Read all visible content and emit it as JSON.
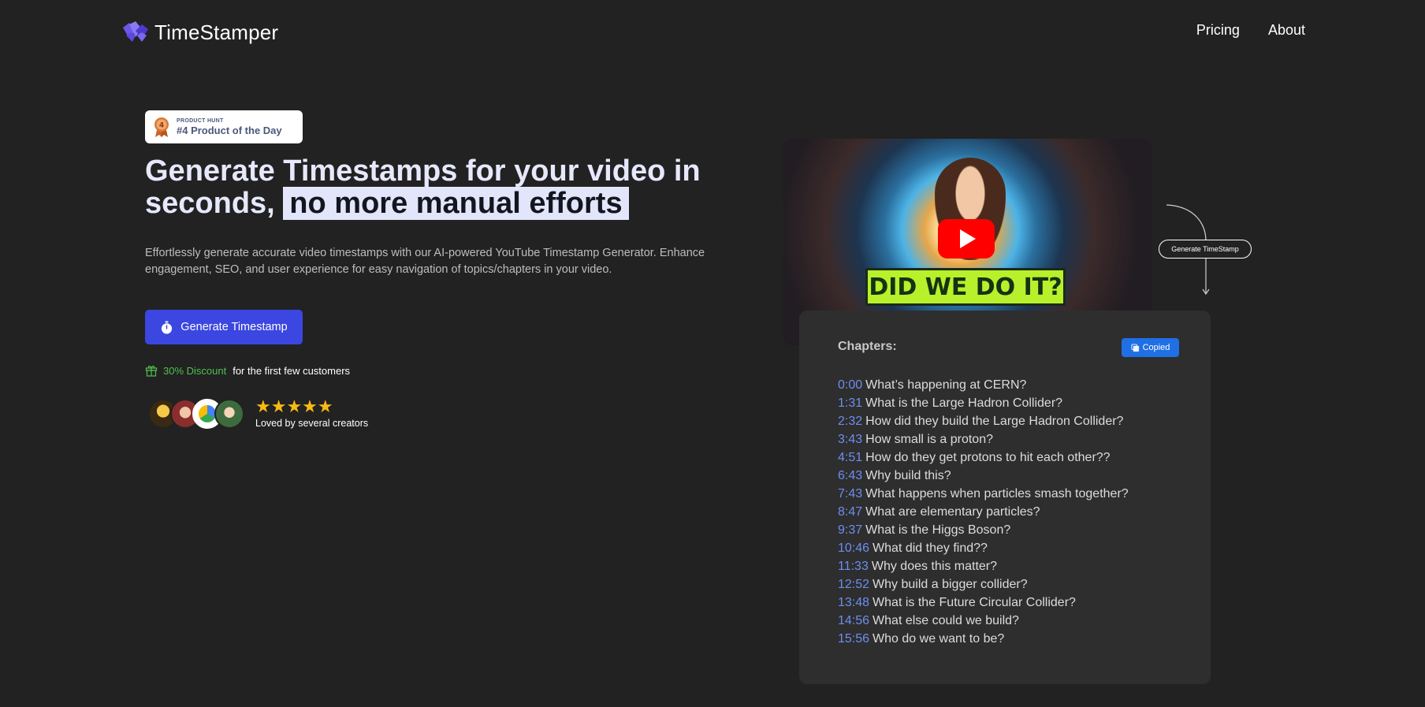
{
  "header": {
    "brand": "TimeStamper",
    "nav": [
      "Pricing",
      "About"
    ]
  },
  "badge": {
    "small": "PRODUCT HUNT",
    "big": "#4 Product of the Day",
    "medal_number": "4"
  },
  "hero": {
    "headline_plain": "Generate Timestamps for your video in seconds,",
    "headline_highlight": "no more manual efforts",
    "subtext": "Effortlessly generate accurate video timestamps with our AI-powered YouTube Timestamp Generator. Enhance engagement, SEO, and user experience for easy navigation of topics/chapters in your video.",
    "cta_label": "Generate Timestamp",
    "discount_highlight": "30% Discount",
    "discount_rest": "for the first few customers",
    "stars": "★★★★★",
    "rating_text": "Loved by several creators"
  },
  "video": {
    "thumbnail_title": "DID WE DO IT?"
  },
  "arrow_button_label": "Generate TimeStamp",
  "chapters": {
    "title": "Chapters:",
    "copied_label": "Copied",
    "items": [
      {
        "time": "0:00",
        "text": "What’s happening at CERN?"
      },
      {
        "time": "1:31",
        "text": "What is the Large Hadron Collider?"
      },
      {
        "time": "2:32",
        "text": "How did they build the Large Hadron Collider?"
      },
      {
        "time": "3:43",
        "text": "How small is a proton?"
      },
      {
        "time": "4:51",
        "text": "How do they get protons to hit each other??"
      },
      {
        "time": "6:43",
        "text": "Why build this?"
      },
      {
        "time": "7:43",
        "text": "What happens when particles smash together?"
      },
      {
        "time": "8:47",
        "text": "What are elementary particles?"
      },
      {
        "time": "9:37",
        "text": "What is the Higgs Boson?"
      },
      {
        "time": "10:46",
        "text": "What did they find??"
      },
      {
        "time": "11:33",
        "text": "Why does this matter?"
      },
      {
        "time": "12:52",
        "text": "Why build a bigger collider?"
      },
      {
        "time": "13:48",
        "text": "What is the Future Circular Collider?"
      },
      {
        "time": "14:56",
        "text": "What else could we build?"
      },
      {
        "time": "15:56",
        "text": "Who do we want to be?"
      }
    ]
  },
  "colors": {
    "background": "#222222",
    "accent": "#3b47e0",
    "timestamp": "#6d8ef0",
    "discount": "#4ec04e",
    "star": "#f9b915"
  }
}
